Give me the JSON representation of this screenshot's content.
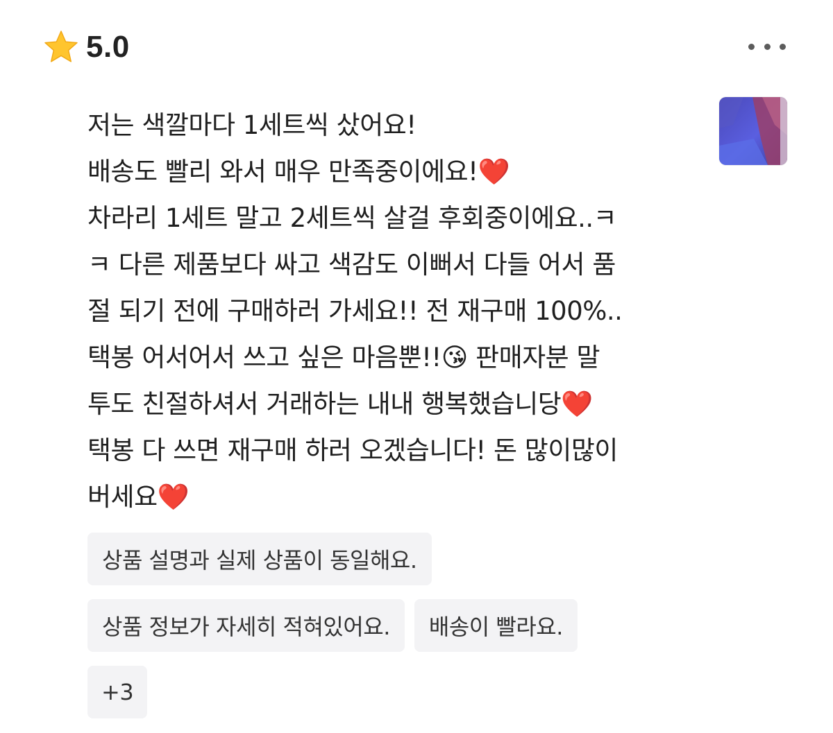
{
  "review": {
    "rating": {
      "star_icon": "star-icon",
      "score": "5.0"
    },
    "more_icon": "more-horizontal-icon",
    "body": "저는 색깔마다 1세트씩 샀어요!\n배송도 빨리 와서 매우 만족중이에요!❤️\n차라리 1세트 말고 2세트씩 살걸 후회중이에요..ㅋ\nㅋ 다른 제품보다 싸고 색감도 이뻐서 다들 어서 품\n절 되기 전에 구매하러 가세요!! 전 재구매 100%..\n택봉 어서어서 쓰고 싶은 마음뿐!!😘 판매자분 말\n투도 친절하셔서 거래하는 내내 행복했습니당❤️\n택봉 다 쓰면 재구매 하러 오겠습니다! 돈 많이많이\n버세요❤️",
    "tags": [
      "상품 설명과 실제 상품이 동일해요.",
      "상품 정보가 자세히 적혀있어요.",
      "배송이 빨라요."
    ],
    "more_tags": "+3"
  },
  "colors": {
    "star": "#FFC52E",
    "tag_background": "#F3F3F5",
    "text": "#1F1F1F",
    "dots": "#5C5C5C"
  }
}
